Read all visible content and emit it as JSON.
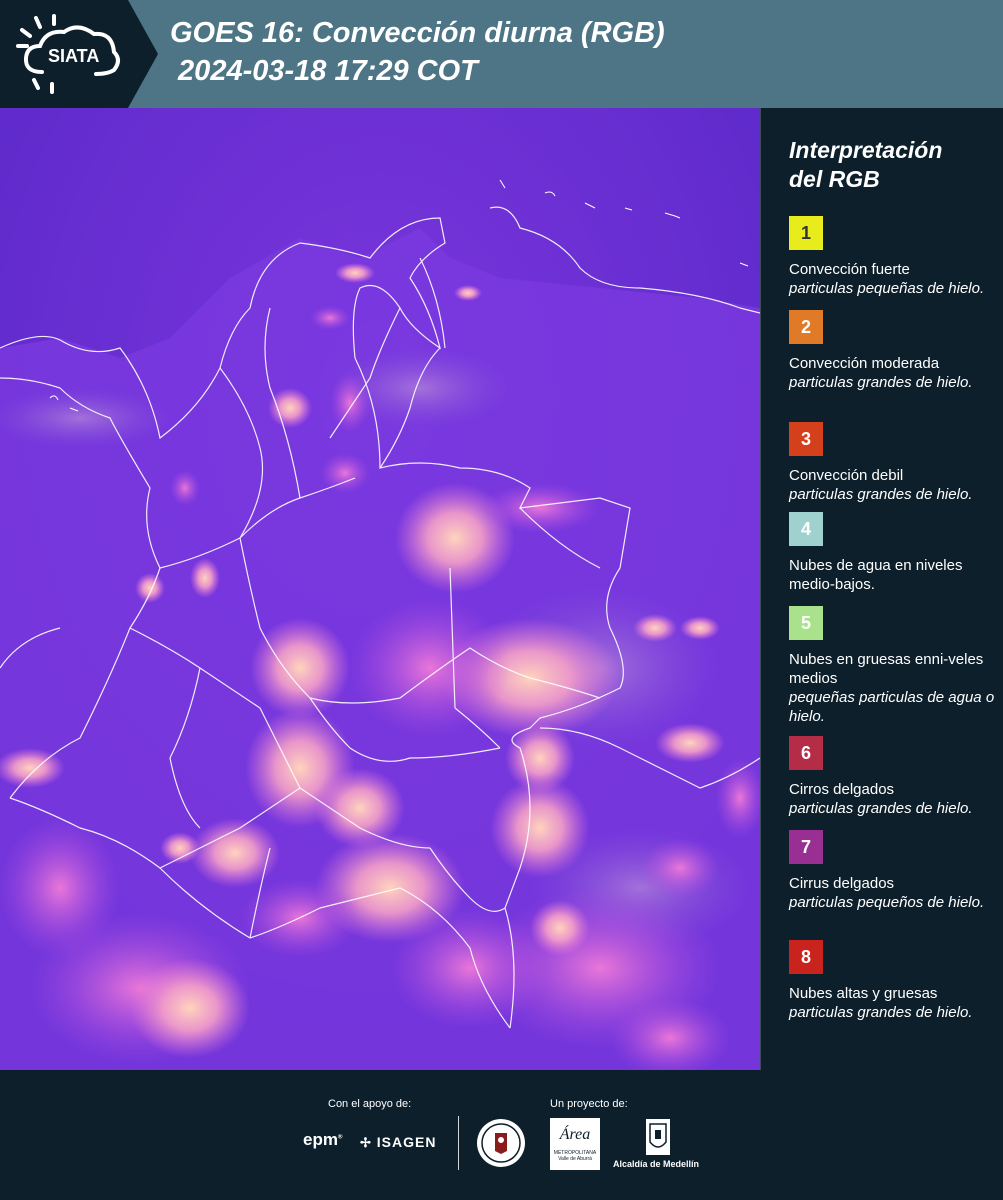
{
  "header": {
    "logo_text": "SIATA",
    "title_line1": "GOES 16: Convección diurna (RGB)",
    "title_line2": " 2024-03-18 17:29 COT"
  },
  "legend": {
    "title_line1": "Interpretación",
    "title_line2": "del RGB",
    "items": [
      {
        "num": "1",
        "color": "#e8ec1c",
        "num_color": "#333333",
        "label": "Convección fuerte",
        "desc": "particulas pequeñas de hielo."
      },
      {
        "num": "2",
        "color": "#e17a26",
        "num_color": "#ffffff",
        "label": "Convección moderada",
        "desc": "particulas grandes de hielo."
      },
      {
        "num": "3",
        "color": "#d5401c",
        "num_color": "#ffffff",
        "label": "Convección debil",
        "desc": "particulas grandes de hielo."
      },
      {
        "num": "4",
        "color": "#9fd1ce",
        "num_color": "#ffffff",
        "label": "Nubes de agua en niveles medio-bajos.",
        "desc": ""
      },
      {
        "num": "5",
        "color": "#a9e28a",
        "num_color": "#ffffff",
        "label": "Nubes en gruesas enni-veles medios",
        "desc": "pequeñas particulas de agua o hielo."
      },
      {
        "num": "6",
        "color": "#b52c47",
        "num_color": "#ffffff",
        "label": "Cirros delgados",
        "desc": "particulas grandes de hielo."
      },
      {
        "num": "7",
        "color": "#9a2f93",
        "num_color": "#ffffff",
        "label": "Cirrus delgados",
        "desc": "particulas pequeños de hielo."
      },
      {
        "num": "8",
        "color": "#c8231c",
        "num_color": "#ffffff",
        "label": "Nubes altas y gruesas",
        "desc": "particulas grandes de hielo."
      }
    ]
  },
  "footer": {
    "support_label": "Con el apoyo de:",
    "project_label": "Un proyecto de:",
    "epm_text": "epm",
    "isagen_text": "ISAGEN",
    "area_text": "Área",
    "area_sub1": "METROPOLITANA",
    "area_sub2": "Valle de Aburrá",
    "alcaldia_text": "Alcaldía de Medellín"
  }
}
